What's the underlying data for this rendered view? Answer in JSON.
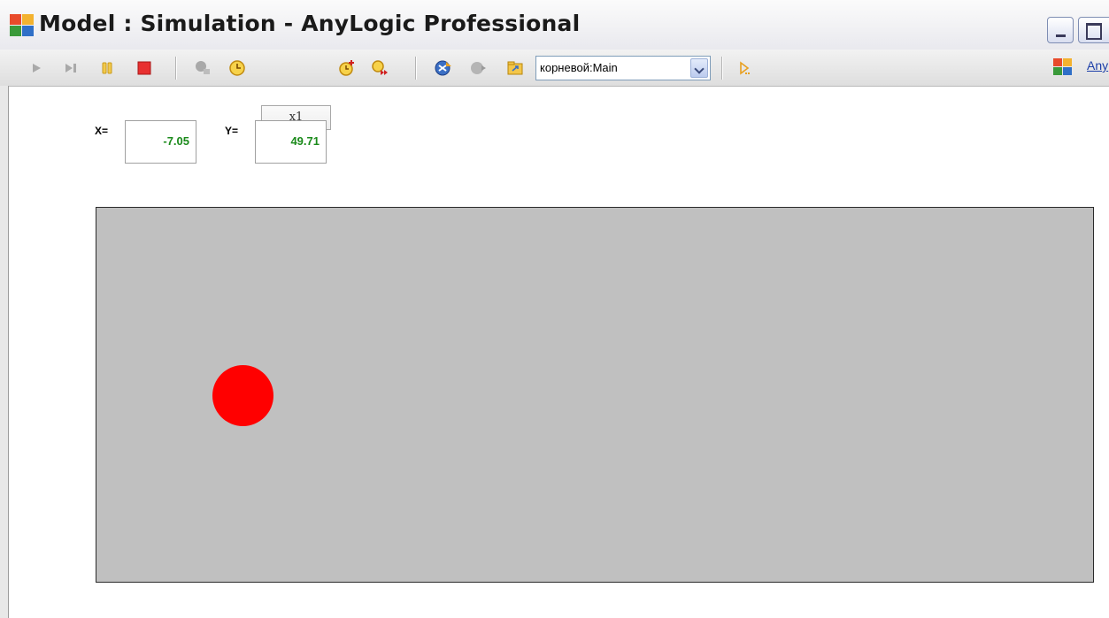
{
  "window": {
    "title": "Model : Simulation - AnyLogic Professional"
  },
  "toolbar": {
    "speed_label": "x1",
    "experiment_selector": "корневой:Main",
    "anylogic_link": "Any"
  },
  "icons": {
    "app": "anylogic-logo-icon",
    "run": "play-icon",
    "step": "step-icon",
    "pause": "pause-icon",
    "stop": "stop-icon",
    "slower": "slower-icon",
    "realtime": "realtime-clock-icon",
    "faster": "faster-icon",
    "virtual_time": "virtual-time-icon",
    "navigate_up": "navigate-up-icon",
    "home": "home-icon",
    "navigate_to": "navigate-to-icon",
    "console": "console-icon"
  },
  "readout": {
    "x_label": "X=",
    "x_value": "-7.05",
    "y_label": "Y=",
    "y_value": "49.71"
  },
  "colors": {
    "canvas": "#c0c0c0",
    "ball": "#ff0000",
    "value_text": "#1a8a1a",
    "stop_button": "#e83030"
  }
}
